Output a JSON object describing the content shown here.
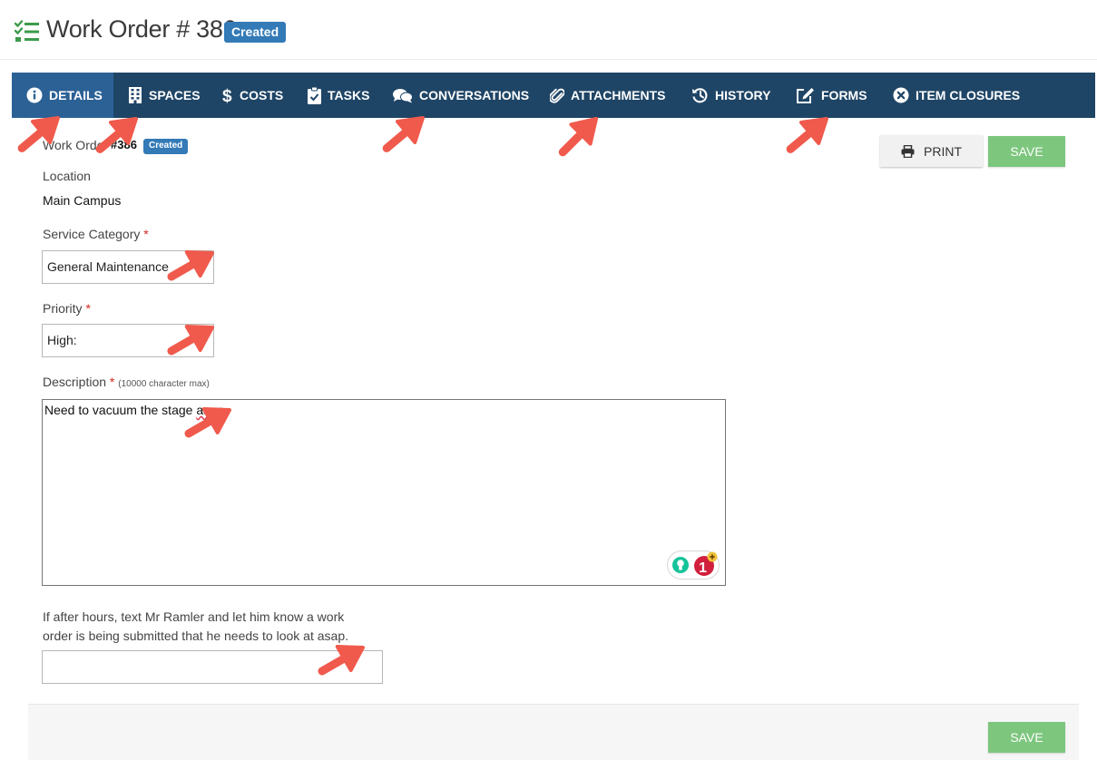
{
  "header": {
    "title": "Work Order # 386",
    "status": "Created"
  },
  "tabs": [
    {
      "label": "DETAILS",
      "icon": "info-circle-icon",
      "active": true
    },
    {
      "label": "SPACES",
      "icon": "building-icon"
    },
    {
      "label": "COSTS",
      "icon": "dollar-icon"
    },
    {
      "label": "TASKS",
      "icon": "clipboard-check-icon"
    },
    {
      "label": "CONVERSATIONS",
      "icon": "comments-icon"
    },
    {
      "label": "ATTACHMENTS",
      "icon": "paperclip-icon"
    },
    {
      "label": "HISTORY",
      "icon": "history-icon"
    },
    {
      "label": "FORMS",
      "icon": "edit-icon"
    },
    {
      "label": "ITEM CLOSURES",
      "icon": "times-circle-icon"
    }
  ],
  "details": {
    "work_order_label": "Work Order",
    "work_order_number": "#386",
    "status": "Created",
    "location_label": "Location",
    "location_value": "Main Campus",
    "service_category_label": "Service Category",
    "service_category_value": "General Maintenance",
    "priority_label": "Priority",
    "priority_value": "High:",
    "required_mark": "*",
    "description_label": "Description",
    "description_note": "(10000 character max)",
    "description_value_prefix": "Need to vacuum the stage ",
    "description_value_misspelled": "asap",
    "grammarly_count": "1",
    "after_hours_line1": "If after hours, text Mr Ramler and let him know a work",
    "after_hours_line2": "order is being submitted that he needs to look at asap.",
    "after_hours_value": ""
  },
  "actions": {
    "print_label": "PRINT",
    "save_label": "SAVE"
  },
  "colors": {
    "nav_bg": "#1f4566",
    "nav_active": "#2c6196",
    "badge": "#337ab7",
    "save": "#7dc67e",
    "arrow": "#f05a4c",
    "required": "#d9241c"
  }
}
